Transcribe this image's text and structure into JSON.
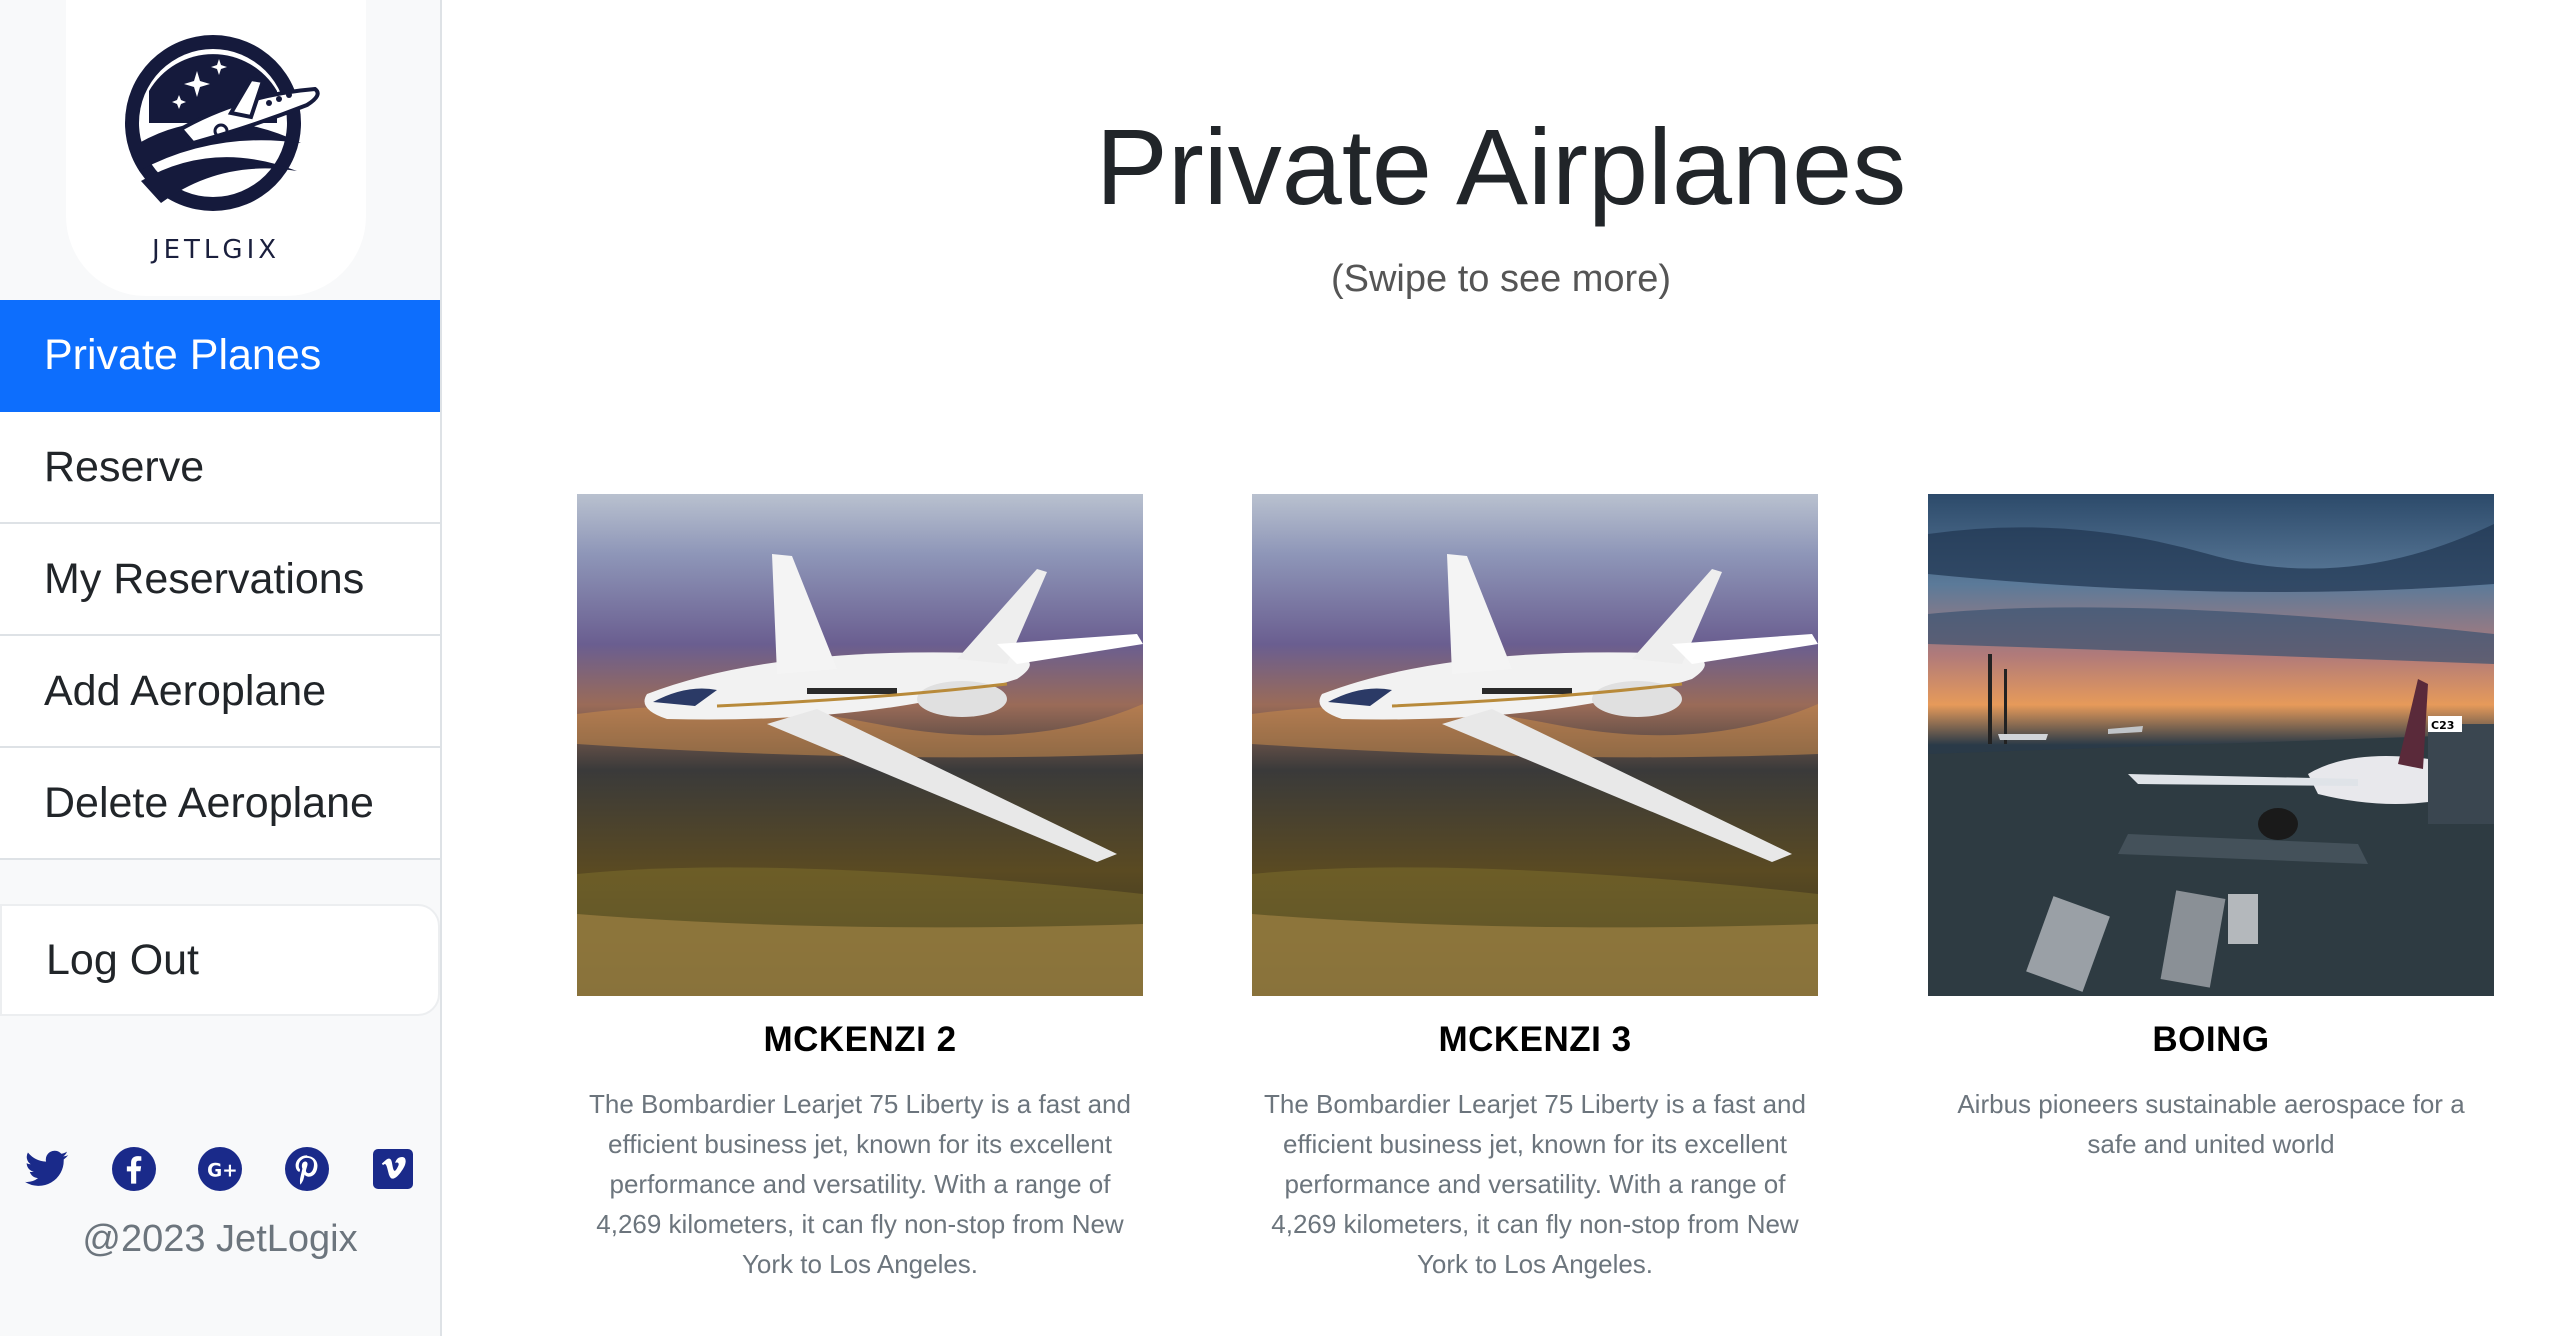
{
  "brand": {
    "logo_text": "JETLGIX",
    "copyright": "@2023 JetLogix"
  },
  "sidebar": {
    "items": [
      {
        "label": "Private Planes",
        "active": true
      },
      {
        "label": "Reserve",
        "active": false
      },
      {
        "label": "My Reservations",
        "active": false
      },
      {
        "label": "Add Aeroplane",
        "active": false
      },
      {
        "label": "Delete Aeroplane",
        "active": false
      }
    ],
    "logout_label": "Log Out",
    "socials": [
      "twitter-icon",
      "facebook-icon",
      "google-plus-icon",
      "pinterest-icon",
      "vimeo-icon"
    ]
  },
  "main": {
    "title": "Private Airplanes",
    "subtitle": "(Swipe to see more)",
    "planes": [
      {
        "name": "MCKENZI 2",
        "description": "The Bombardier Learjet 75 Liberty is a fast and efficient business jet, known for its excellent performance and versatility. With a range of 4,269 kilometers, it can fly non-stop from New York to Los Angeles."
      },
      {
        "name": "MCKENZI 3",
        "description": "The Bombardier Learjet 75 Liberty is a fast and efficient business jet, known for its excellent performance and versatility. With a range of 4,269 kilometers, it can fly non-stop from New York to Los Angeles."
      },
      {
        "name": "BOING",
        "description": "Airbus pioneers sustainable aerospace for a safe and united world",
        "gate_label": "C23"
      }
    ]
  },
  "colors": {
    "primary": "#0d6efd",
    "sidebar_bg": "#f8f9fa",
    "social_icon": "#1a2a8a",
    "text_muted": "#6c757d"
  }
}
